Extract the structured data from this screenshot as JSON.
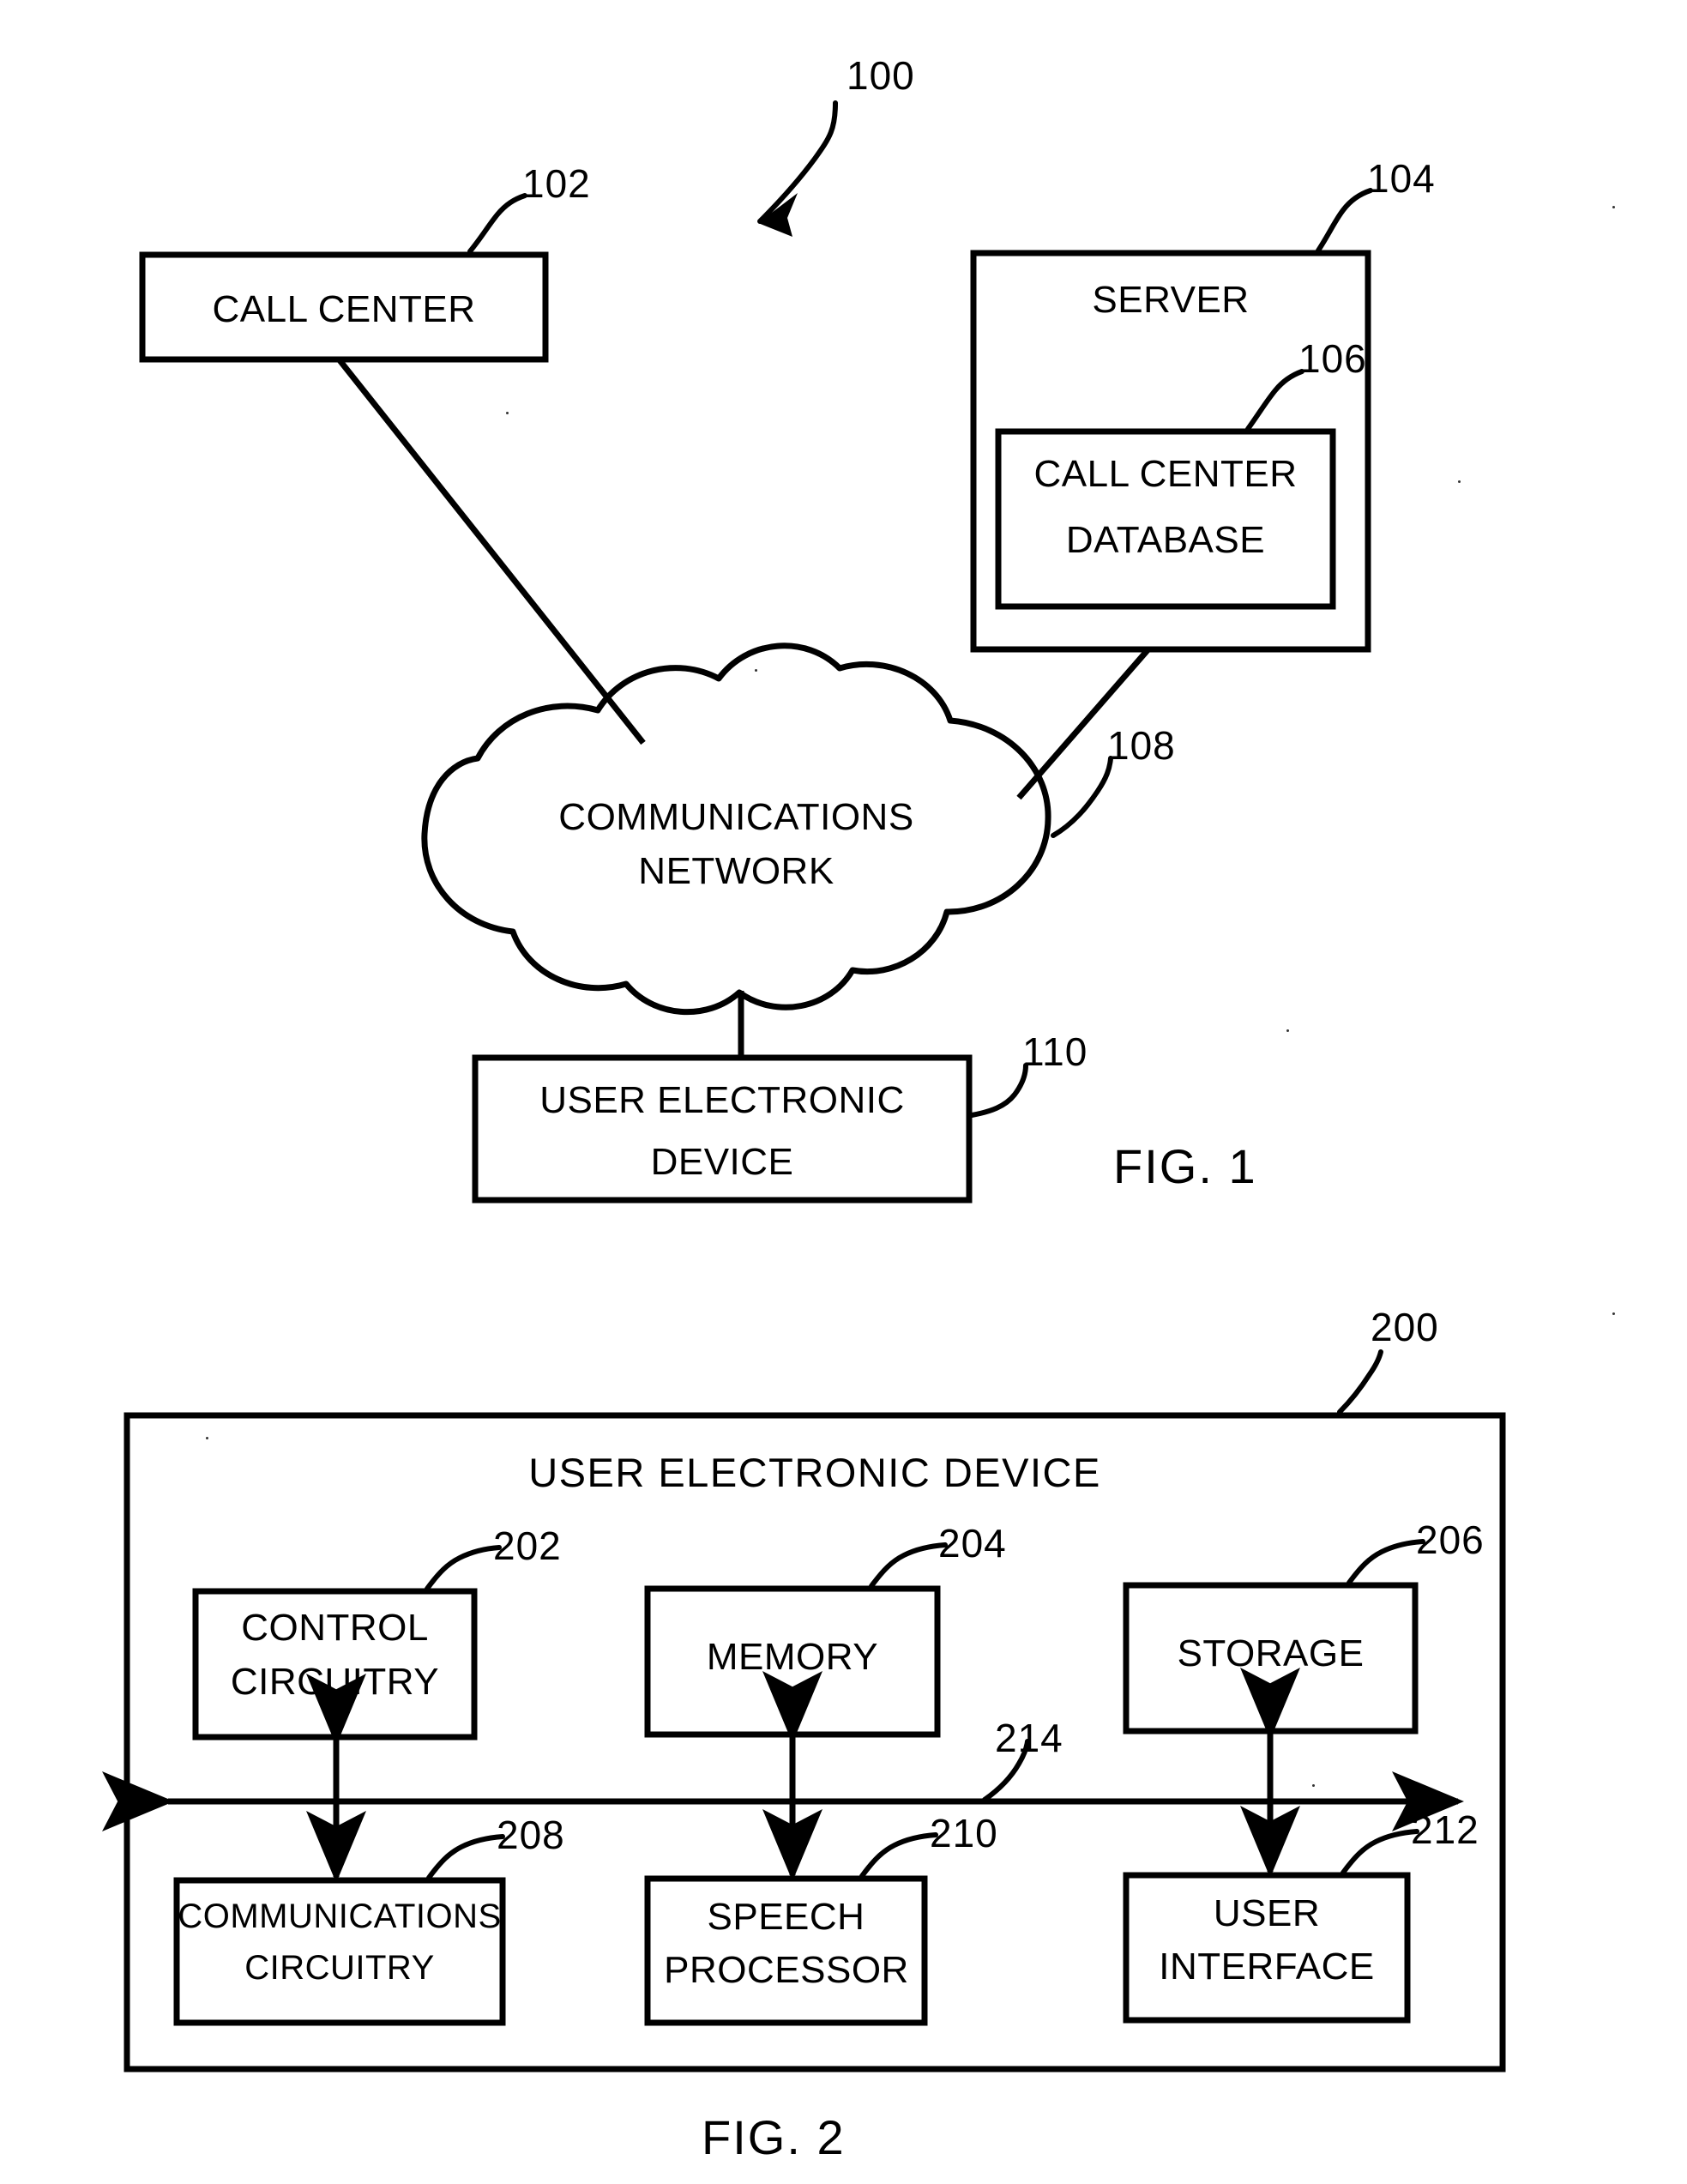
{
  "document": {
    "kind": "patent-drawing-sheet",
    "figures": [
      "FIG. 1",
      "FIG. 2"
    ]
  },
  "fig1": {
    "caption": "FIG. 1",
    "system_ref": "100",
    "nodes": {
      "call_center": {
        "label": "CALL CENTER",
        "ref": "102"
      },
      "server": {
        "label": "SERVER",
        "ref": "104"
      },
      "call_center_database": {
        "label_line1": "CALL CENTER",
        "label_line2": "DATABASE",
        "ref": "106"
      },
      "network": {
        "label_line1": "COMMUNICATIONS",
        "label_line2": "NETWORK",
        "ref": "108"
      },
      "user_device": {
        "label_line1": "USER ELECTRONIC",
        "label_line2": "DEVICE",
        "ref": "110"
      }
    },
    "connections": [
      {
        "from": "call_center",
        "to": "network"
      },
      {
        "from": "server",
        "to": "network"
      },
      {
        "from": "network",
        "to": "user_device"
      }
    ]
  },
  "fig2": {
    "caption": "FIG. 2",
    "device_ref": "200",
    "title": "USER ELECTRONIC DEVICE",
    "bus": {
      "ref": "214"
    },
    "blocks": [
      {
        "label_line1": "CONTROL",
        "label_line2": "CIRCUITRY",
        "ref": "202",
        "row": "top",
        "col": 0
      },
      {
        "label_line1": "MEMORY",
        "label_line2": "",
        "ref": "204",
        "row": "top",
        "col": 1
      },
      {
        "label_line1": "STORAGE",
        "label_line2": "",
        "ref": "206",
        "row": "top",
        "col": 2
      },
      {
        "label_line1": "COMMUNICATIONS",
        "label_line2": "CIRCUITRY",
        "ref": "208",
        "row": "bottom",
        "col": 0
      },
      {
        "label_line1": "SPEECH",
        "label_line2": "PROCESSOR",
        "ref": "210",
        "row": "bottom",
        "col": 1
      },
      {
        "label_line1": "USER",
        "label_line2": "INTERFACE",
        "ref": "212",
        "row": "bottom",
        "col": 2
      }
    ]
  },
  "colors": {
    "ink": "#000000",
    "paper": "#ffffff"
  }
}
